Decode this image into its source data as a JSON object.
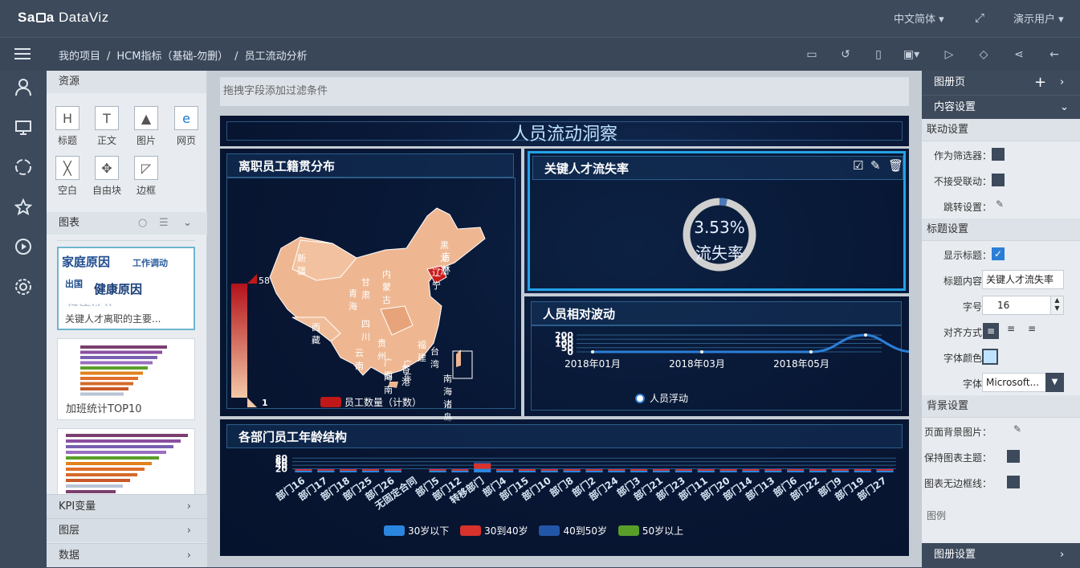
{
  "app": {
    "logo": "SaCa DataViz",
    "language": "中文简体",
    "user": "演示用户"
  },
  "breadcrumb": [
    "我的项目",
    "HCM指标（基础-勿删）",
    "员工流动分析"
  ],
  "resources": {
    "header": "资源",
    "items": [
      "标题",
      "正文",
      "图片",
      "网页",
      "空白",
      "自由块",
      "边框"
    ]
  },
  "charts_panel": {
    "header": "图表",
    "thumbs": [
      {
        "caption": "关键人才离职的主要...",
        "words": [
          "家庭原因",
          "工作调动",
          "出国",
          "健康原因",
          "经济地位"
        ]
      },
      {
        "caption": "加班统计TOP10"
      },
      {
        "caption": ""
      }
    ]
  },
  "accordions": [
    "KPI变量",
    "图层",
    "数据"
  ],
  "filter_placeholder": "拖拽字段添加过滤条件",
  "dashboard": {
    "title": "人员流动洞察",
    "map_card": {
      "title": "离职员工籍贯分布",
      "legend_max": "58",
      "legend_min": "1",
      "series": "员工数量（计数）",
      "provinces": [
        "新疆",
        "西藏",
        "青海",
        "甘肃",
        "内蒙古",
        "黑龙江",
        "吉林",
        "辽宁",
        "四川",
        "云南",
        "贵州",
        "广西",
        "广东",
        "福建",
        "台湾",
        "海南",
        "香港",
        "南海诸岛"
      ]
    },
    "kpi_card": {
      "title": "关键人才流失率",
      "value": "3.53%",
      "label": "流失率",
      "ratio": 0.0353
    },
    "wave_card": {
      "title": "人员相对波动",
      "legend": "人员浮动"
    },
    "dept_card": {
      "title": "各部门员工年龄结构",
      "legend": [
        "30岁以下",
        "30到40岁",
        "40到50岁",
        "50岁以上"
      ]
    }
  },
  "chart_data": [
    {
      "type": "line",
      "x": [
        "2018年01月",
        "2018年03月",
        "2018年05月"
      ],
      "y_ticks": [
        "200",
        "150",
        "100",
        "50",
        "0"
      ],
      "series": [
        {
          "name": "人员浮动",
          "values": [
            0,
            0,
            0,
            0,
            0,
            200
          ]
        }
      ],
      "color": "#2b7ed6"
    },
    {
      "type": "bar",
      "categories": [
        "部门16",
        "部门17",
        "部门18",
        "部门25",
        "部门26",
        "无固定合同",
        "部门5",
        "部门12",
        "转移部门",
        "部门4",
        "部门15",
        "部门10",
        "部门8",
        "部门2",
        "部门24",
        "部门3",
        "部门21",
        "部门23",
        "部门11",
        "部门20",
        "部门14",
        "部门13",
        "部门6",
        "部门22",
        "部门9",
        "部门19",
        "部门27"
      ],
      "y_ticks": [
        "80",
        "60",
        "40",
        "20"
      ],
      "series": [
        {
          "name": "30岁以下",
          "values": [
            10,
            10,
            10,
            10,
            10,
            0,
            10,
            10,
            20,
            10,
            10,
            10,
            10,
            10,
            10,
            10,
            10,
            10,
            10,
            10,
            10,
            10,
            10,
            10,
            10,
            10,
            10
          ]
        },
        {
          "name": "30到40岁",
          "values": [
            8,
            8,
            8,
            8,
            8,
            0,
            8,
            8,
            30,
            8,
            8,
            8,
            8,
            8,
            8,
            8,
            8,
            8,
            8,
            8,
            8,
            8,
            8,
            8,
            8,
            8,
            8
          ]
        },
        {
          "name": "40到50岁",
          "values": [
            4,
            4,
            4,
            4,
            4,
            0,
            4,
            4,
            6,
            4,
            4,
            4,
            4,
            4,
            4,
            4,
            4,
            4,
            4,
            4,
            4,
            4,
            4,
            4,
            4,
            4,
            4
          ]
        },
        {
          "name": "50岁以上",
          "values": [
            0,
            0,
            0,
            0,
            0,
            0,
            0,
            0,
            0,
            0,
            0,
            0,
            0,
            0,
            0,
            0,
            0,
            0,
            0,
            0,
            0,
            0,
            0,
            0,
            0,
            0,
            0
          ]
        }
      ],
      "colors": [
        "#2b86e0",
        "#d8322c",
        "#2456a8",
        "#5a9e2a"
      ]
    }
  ],
  "right_panel": {
    "album": "图册页",
    "content": "内容设置",
    "link_section": "联动设置",
    "as_filter": "作为筛选器：",
    "no_link": "不接受联动：",
    "jump": "跳转设置：",
    "title_section": "标题设置",
    "show_title": "显示标题：",
    "title_content_label": "标题内容：",
    "title_content": "关键人才流失率",
    "font_size_label": "字号：",
    "font_size": "16",
    "align_label": "对齐方式：",
    "font_color_label": "字体颜色：",
    "font_label": "字体：",
    "font_value": "Microsoft...",
    "bg_section": "背景设置",
    "bg_image": "页面背景图片：",
    "keep_theme": "保持图表主题：",
    "no_border": "图表无边框线：",
    "legend": "图例",
    "album_settings": "图册设置"
  }
}
